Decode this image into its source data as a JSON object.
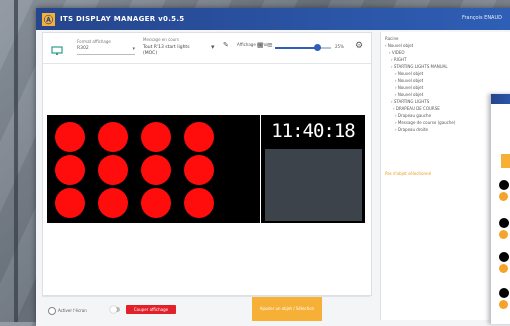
{
  "app": {
    "title": "ITS DISPLAY MANAGER v0.5.5",
    "user": "François ENAUD",
    "close_glyph": "×"
  },
  "toolbar": {
    "format_label": "Format affichage",
    "format_value": "R302",
    "message_label": "Message en cours",
    "message_value": "Tout R'13 start lights (MOC)",
    "flip_label": "Affichage miroir",
    "zoom_value": "25%",
    "zoom_level": 0.75
  },
  "display": {
    "clock": "11:40:18",
    "led_color": "#ff0c0c",
    "led_rows": 3,
    "led_cols": 4
  },
  "tree": {
    "items": [
      "Racine",
      "Nouvel objet",
      "VIDEO",
      "RIGHT",
      "STARTING LIGHTS MANUAL",
      "Nouvel objet",
      "Nouvel objet",
      "Nouvel objet",
      "Nouvel objet",
      "STARTING LIGHTS",
      "DRAPEAU DE COURSE",
      "Drapeau gauche",
      "Message de course (gauche)",
      "Drapeau droite"
    ],
    "no_object_text": "Pas d'objet sélectionné"
  },
  "bottombar": {
    "live_label": "Activer l'écran",
    "red_button": "Couper affichage",
    "orange_button": "Ajouter un objet / Sélection"
  },
  "colors": {
    "titlebar": "#2f5fb7",
    "accent_orange": "#f6b036",
    "accent_red": "#e2222a"
  }
}
